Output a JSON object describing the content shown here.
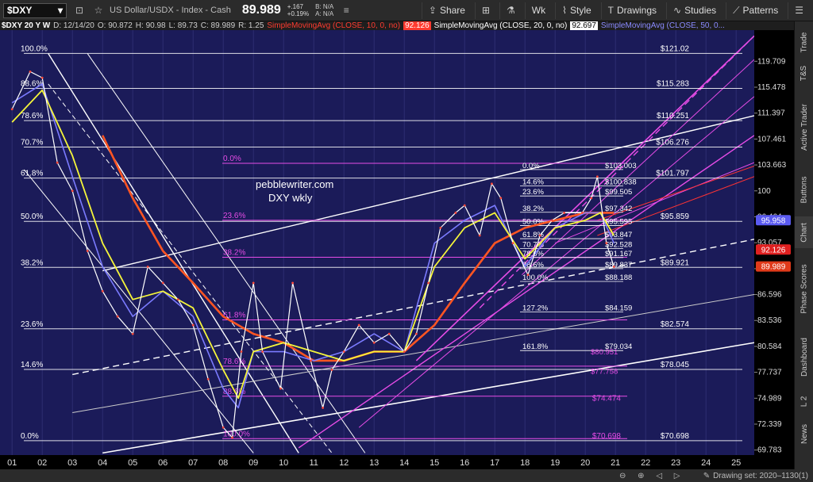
{
  "header": {
    "symbol": "$DXY",
    "description": "US Dollar/USDX - Index - Cash",
    "last": "89.989",
    "change": "+.167",
    "change_pct": "+0.19%",
    "bid": "B: N/A",
    "ask": "A: N/A",
    "buttons": {
      "share": "Share",
      "timeframe": "Wk",
      "style": "Style",
      "drawings": "Drawings",
      "studies": "Studies",
      "patterns": "Patterns"
    }
  },
  "infobar": {
    "title": "$DXY 20 Y W",
    "date": "D: 12/14/20",
    "open": "O: 90.872",
    "high": "H: 90.98",
    "low": "L: 89.73",
    "close": "C: 89.989",
    "range": "R: 1.25",
    "sma10": "SimpleMovingAvg (CLOSE, 10, 0, no)",
    "sma10_val": "92.126",
    "sma20": "SimpleMovingAvg (CLOSE, 20, 0, no)",
    "sma20_val": "92.697",
    "sma50": "SimpleMovingAvg (CLOSE, 50, 0..."
  },
  "sidebar": {
    "tabs": [
      "Trade",
      "T&S",
      "Active Trader",
      "Buttons",
      "Chart",
      "Phase Scores",
      "Dashboard",
      "L 2",
      "News"
    ]
  },
  "status": {
    "drawing_set": "Drawing set: 2020–1130(1)"
  },
  "annotations": {
    "watermark_1": "pebblewriter.com",
    "watermark_2": "DXY wkly"
  },
  "colors": {
    "bg": "#1b1b59",
    "sma10": "#ff3b2f",
    "sma20": "#f5f53a",
    "sma50": "#7b7bff",
    "sma200": "#ff5522",
    "channel": "#e64ce6",
    "fib": "#ffffff"
  },
  "chart_data": {
    "type": "line",
    "title": "",
    "x_range_years": [
      2000.6,
      2025.6
    ],
    "ylim": [
      69.3,
      125.0
    ],
    "y_scale": "log",
    "x_ticks": [
      "01",
      "02",
      "03",
      "04",
      "05",
      "06",
      "07",
      "08",
      "09",
      "10",
      "11",
      "12",
      "13",
      "14",
      "15",
      "16",
      "17",
      "18",
      "19",
      "20",
      "21",
      "22",
      "23",
      "24",
      "25"
    ],
    "y_ticks": [
      "119.709",
      "115.478",
      "111.397",
      "107.461",
      "103.663",
      "100",
      "96.464",
      "93.057",
      "89.760",
      "86.596",
      "83.536",
      "80.584",
      "77.737",
      "74.989",
      "72.339",
      "69.783"
    ],
    "price_labels": [
      {
        "text": "95.958",
        "value": 95.958,
        "color": "#5a5af0"
      },
      {
        "text": "92.126",
        "value": 92.126,
        "color": "#e02020"
      },
      {
        "text": "89.989",
        "value": 89.989,
        "color": "#e03a1a"
      }
    ],
    "series": [
      {
        "name": "price",
        "color": "#ffffff",
        "x": [
          2001.0,
          2001.6,
          2002.0,
          2002.5,
          2003.0,
          2003.5,
          2004.0,
          2004.5,
          2005.0,
          2005.5,
          2006.0,
          2006.5,
          2007.0,
          2007.5,
          2008.0,
          2008.3,
          2008.6,
          2009.0,
          2009.3,
          2009.9,
          2010.3,
          2010.9,
          2011.3,
          2011.6,
          2012.0,
          2012.5,
          2013.0,
          2013.5,
          2014.0,
          2014.4,
          2014.8,
          2015.2,
          2015.7,
          2016.0,
          2016.5,
          2016.9,
          2017.2,
          2017.6,
          2018.1,
          2018.5,
          2018.9,
          2019.3,
          2019.9,
          2020.2,
          2020.4,
          2020.7,
          2020.95
        ],
        "values": [
          112,
          118,
          117,
          104,
          100,
          92,
          87,
          84,
          82,
          90,
          88,
          86,
          83,
          77,
          72,
          71,
          80,
          88,
          80,
          76,
          88,
          79,
          74,
          78,
          80,
          83,
          81,
          82,
          80,
          82,
          88,
          95,
          97,
          98,
          94,
          101,
          99,
          93,
          89,
          94,
          96,
          97,
          97,
          99,
          102,
          93,
          90
        ]
      },
      {
        "name": "",
        "color": "#7b7bff",
        "x": [
          2001.0,
          2002.0,
          2003.0,
          2004.0,
          2005.0,
          2006.0,
          2007.0,
          2008.0,
          2008.5,
          2009.0,
          2010.0,
          2011.0,
          2012.0,
          2013.0,
          2014.0,
          2015.0,
          2016.0,
          2017.0,
          2018.0,
          2019.0,
          2020.0,
          2020.5,
          2020.95
        ],
        "values": [
          113,
          116,
          102,
          90,
          84,
          87,
          84,
          76,
          74,
          80,
          80,
          79,
          80,
          82,
          80,
          93,
          96,
          98,
          90,
          95,
          97,
          97,
          93
        ]
      },
      {
        "name": "",
        "color": "#f5f53a",
        "x": [
          2001.0,
          2002.0,
          2003.0,
          2004.0,
          2005.0,
          2006.0,
          2007.0,
          2008.0,
          2008.5,
          2009.0,
          2010.0,
          2011.0,
          2012.0,
          2013.0,
          2014.0,
          2015.0,
          2016.0,
          2017.0,
          2018.0,
          2019.0,
          2020.0,
          2020.5,
          2020.95
        ],
        "values": [
          110,
          115,
          105,
          93,
          86,
          87,
          85,
          78,
          75,
          80,
          81,
          80,
          79,
          80,
          80,
          90,
          95,
          97,
          91,
          95,
          96,
          97,
          94
        ]
      },
      {
        "name": "",
        "color": "#ff5522",
        "x": [
          2004.0,
          2005.0,
          2006.0,
          2007.0,
          2008.0,
          2009.0,
          2010.0,
          2011.0,
          2012.0,
          2013.0,
          2014.0,
          2015.0,
          2016.0,
          2017.0,
          2018.0,
          2019.0,
          2020.0,
          2020.95
        ],
        "values": [
          108,
          99,
          92,
          88,
          84,
          82,
          81,
          79,
          79,
          80,
          80,
          83,
          88,
          93,
          95,
          96,
          97,
          97
        ]
      }
    ],
    "fib_levels": [
      {
        "label": "100.0%",
        "value": 121.02,
        "text": "$121.02"
      },
      {
        "label": "88.6%",
        "value": 115.283,
        "text": "$115.283"
      },
      {
        "label": "78.6%",
        "value": 110.251,
        "text": "$110.251"
      },
      {
        "label": "70.7%",
        "value": 106.276,
        "text": "$106.276"
      },
      {
        "label": "61.8%",
        "value": 101.797,
        "text": "$101.797"
      },
      {
        "label": "50.0%",
        "value": 95.859,
        "text": "$95.859"
      },
      {
        "label": "38.2%",
        "value": 89.921,
        "text": "$89.921"
      },
      {
        "label": "23.6%",
        "value": 82.574,
        "text": "$82.574"
      },
      {
        "label": "14.6%",
        "value": 78.045,
        "text": "$78.045"
      },
      {
        "label": "0.0%",
        "value": 70.698,
        "text": "$70.698"
      }
    ],
    "fib_magenta": [
      {
        "label": "0.0%",
        "value": 103.9
      },
      {
        "label": "23.6%",
        "value": 96.0
      },
      {
        "label": "38.2%",
        "value": 91.2
      },
      {
        "label": "61.8%",
        "value": 83.6
      },
      {
        "label": "78.6%",
        "value": 78.4
      },
      {
        "label": "88.6%",
        "value": 75.2
      },
      {
        "label": "100.0%",
        "value": 70.9
      }
    ],
    "magenta_prices": [
      {
        "text": "$74.474",
        "value": 74.474
      },
      {
        "text": "$70.698",
        "value": 70.698
      }
    ],
    "fib_small": [
      {
        "label": "0.0%",
        "price": "$103.003"
      },
      {
        "label": "14.6%",
        "price": "$100.838"
      },
      {
        "label": "23.6%",
        "price": "$99.505"
      },
      {
        "label": "38.2%",
        "price": "$97.342"
      },
      {
        "label": "50.0%",
        "price": "$95.595"
      },
      {
        "label": "61.8%",
        "price": "$93.847"
      },
      {
        "label": "70.7%",
        "price": "$92.528"
      },
      {
        "label": "78.6%",
        "price": "$91.167"
      },
      {
        "label": "88.6%",
        "price": "$89.837"
      },
      {
        "label": "100.0%",
        "price": "$88.188"
      },
      {
        "label": "127.2%",
        "price": "$84.159"
      },
      {
        "label": "161.8%",
        "price": "$79.034"
      }
    ],
    "fib_small_extra": [
      "$77.758",
      "$80.951"
    ]
  }
}
